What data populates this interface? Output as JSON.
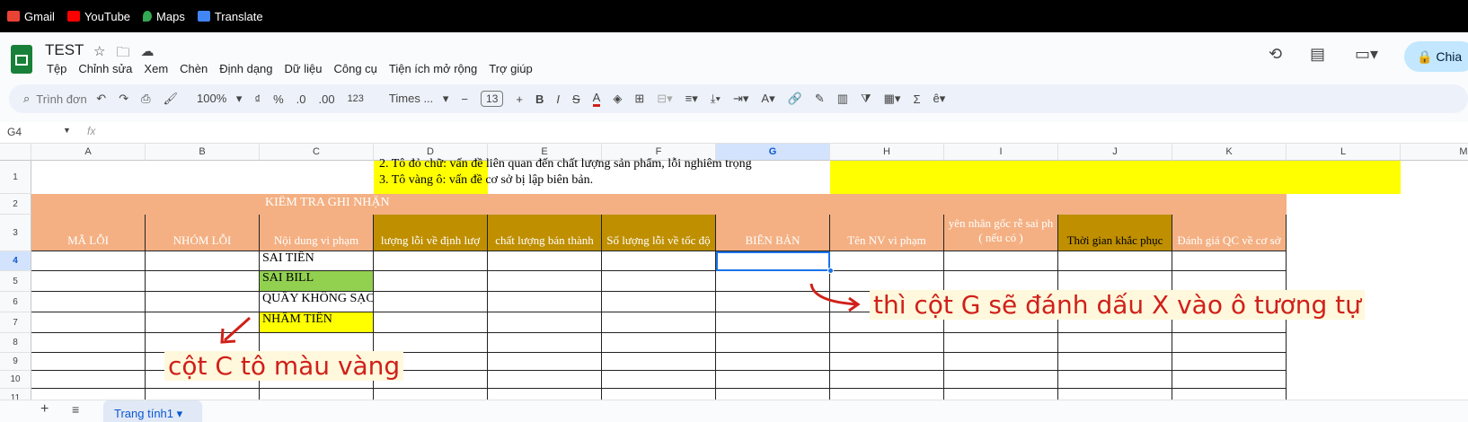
{
  "bookmarks": [
    {
      "label": "Gmail",
      "color": "#ea4335"
    },
    {
      "label": "YouTube",
      "color": "#ff0000"
    },
    {
      "label": "Maps",
      "color": "#34a853"
    },
    {
      "label": "Translate",
      "color": "#4285f4"
    }
  ],
  "doc": {
    "title": "TEST",
    "share_label": "Chia"
  },
  "menu": [
    "Tệp",
    "Chỉnh sửa",
    "Xem",
    "Chèn",
    "Định dạng",
    "Dữ liệu",
    "Công cụ",
    "Tiện ích mở rộng",
    "Trợ giúp"
  ],
  "toolbar": {
    "search_placeholder": "Trình đơn",
    "zoom": "100%",
    "currency": "₫",
    "percent": "%",
    "dec_minus": ".0",
    "dec_plus": ".00",
    "num_format": "123",
    "font": "Times ...",
    "font_size": "13"
  },
  "formula_bar": {
    "cell_ref": "G4",
    "fx": "fx"
  },
  "columns": [
    "A",
    "B",
    "C",
    "D",
    "E",
    "F",
    "G",
    "H",
    "I",
    "J",
    "K",
    "L",
    "M"
  ],
  "rows": [
    "1",
    "2",
    "3",
    "4",
    "5",
    "6",
    "7",
    "8",
    "9",
    "10",
    "11"
  ],
  "sheet": {
    "r1_line2": "2. Tô đỏ chữ: vấn đề liên quan đến chất lượng sản phẩm, lỗi nghiêm trọng",
    "r1_line3": "3. Tô vàng ô: vấn đề cơ sở bị lập biên bản.",
    "r2_title": "KIỂM TRA GHI NHẬN",
    "headers": [
      "MÃ LỖI",
      "NHÓM LỖI",
      "Nội dung vi phạm",
      "lượng lỗi về định lượ",
      "chất lượng bán thành",
      "Số lượng lỗi về tốc độ",
      "BIÊN BẢN",
      "Tên NV vi phạm",
      "yên nhân gốc rễ sai ph",
      "( nếu có )",
      "Thời gian khắc phục",
      "Đánh giá QC về cơ sở"
    ],
    "c4": "SAI TIỀN",
    "c5": "SAI BILL",
    "c6": "QUẦY KHÔNG SẠCH",
    "c7": "NHẦM TIỀN"
  },
  "annotations": {
    "right": "thì cột G sẽ đánh dấu X vào ô tương tự",
    "left": "cột C tô màu vàng"
  },
  "sheet_tab": "Trang tính1",
  "colors": {
    "salmon": "#f4b083",
    "gold": "#bf8f00",
    "yellow": "#ffff00",
    "green": "#92d050",
    "red": "#d0201a"
  }
}
